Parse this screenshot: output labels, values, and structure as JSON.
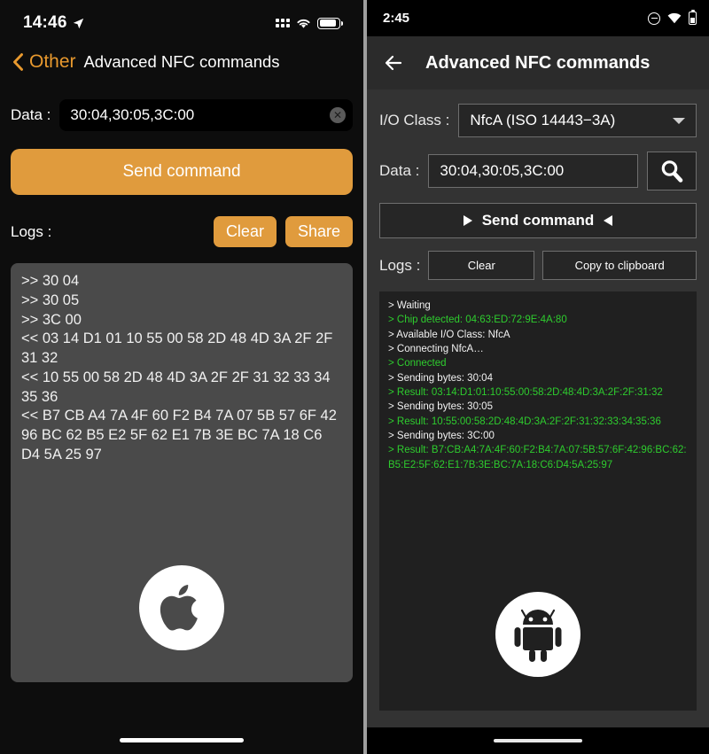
{
  "ios": {
    "status": {
      "time": "14:46",
      "location_icon": "location-arrow-icon",
      "signal_icon": "signal-dots-icon",
      "wifi_icon": "wifi-icon",
      "battery_icon": "battery-icon"
    },
    "nav": {
      "back_label": "Other",
      "title": "Advanced NFC commands"
    },
    "data_field": {
      "label": "Data :",
      "value": "30:04,30:05,3C:00",
      "clear_icon": "clear-circle-icon"
    },
    "send_button": {
      "label": "Send command"
    },
    "logs": {
      "label": "Logs :",
      "clear_label": "Clear",
      "share_label": "Share"
    },
    "log_text": ">> 30 04\n>> 30 05\n>> 3C 00\n<< 03 14 D1 01 10 55 00 58 2D 48 4D 3A 2F 2F 31 32\n<< 10 55 00 58 2D 48 4D 3A 2F 2F 31 32 33 34 35 36\n<< B7 CB A4 7A 4F 60 F2 B4 7A 07 5B 57 6F 42 96 BC 62 B5 E2 5F 62 E1 7B 3E BC 7A 18 C6 D4 5A 25 97",
    "platform_logo": "apple-logo-icon",
    "home_indicator": "home-indicator"
  },
  "android": {
    "status": {
      "time": "2:45",
      "dnd_icon": "do-not-disturb-icon",
      "wifi_icon": "wifi-icon",
      "battery_icon": "battery-icon"
    },
    "appbar": {
      "back_icon": "arrow-left-icon",
      "title": "Advanced NFC commands"
    },
    "io_class": {
      "label": "I/O Class :",
      "value": "NfcA (ISO 14443−3A)",
      "caret_icon": "chevron-down-icon"
    },
    "data_field": {
      "label": "Data :",
      "value": "30:04,30:05,3C:00"
    },
    "search_button": {
      "icon": "magnifier-icon"
    },
    "send_button": {
      "label": "Send command",
      "left_icon": "triangle-right-icon",
      "right_icon": "triangle-left-icon"
    },
    "logs": {
      "label": "Logs :",
      "clear_label": "Clear",
      "copy_label": "Copy to clipboard"
    },
    "log_lines": [
      {
        "text": "> Waiting",
        "color": "white"
      },
      {
        "text": "> Chip detected: 04:63:ED:72:9E:4A:80",
        "color": "green"
      },
      {
        "text": "> Available I/O Class: NfcA",
        "color": "white"
      },
      {
        "text": "> Connecting NfcA…",
        "color": "white"
      },
      {
        "text": "> Connected",
        "color": "green"
      },
      {
        "text": "> Sending bytes: 30:04",
        "color": "white"
      },
      {
        "text": "> Result: 03:14:D1:01:10:55:00:58:2D:48:4D:3A:2F:2F:31:32",
        "color": "green"
      },
      {
        "text": "> Sending bytes: 30:05",
        "color": "white"
      },
      {
        "text": "> Result: 10:55:00:58:2D:48:4D:3A:2F:2F:31:32:33:34:35:36",
        "color": "green"
      },
      {
        "text": "> Sending bytes: 3C:00",
        "color": "white"
      },
      {
        "text": "> Result: B7:CB:A4:7A:4F:60:F2:B4:7A:07:5B:57:6F:42:96:BC:62:B5:E2:5F:62:E1:7B:3E:BC:7A:18:C6:D4:5A:25:97",
        "color": "green"
      }
    ],
    "platform_logo": "android-robot-icon",
    "home_indicator": "home-indicator"
  },
  "colors": {
    "ios_accent": "#e09b3d",
    "ios_background": "#0d0d0d",
    "ios_logbox": "#4a4a4a",
    "android_background": "#333333",
    "android_logbox": "#202020",
    "android_log_green": "#2ecc2e",
    "divider": "#9e9e9e"
  }
}
